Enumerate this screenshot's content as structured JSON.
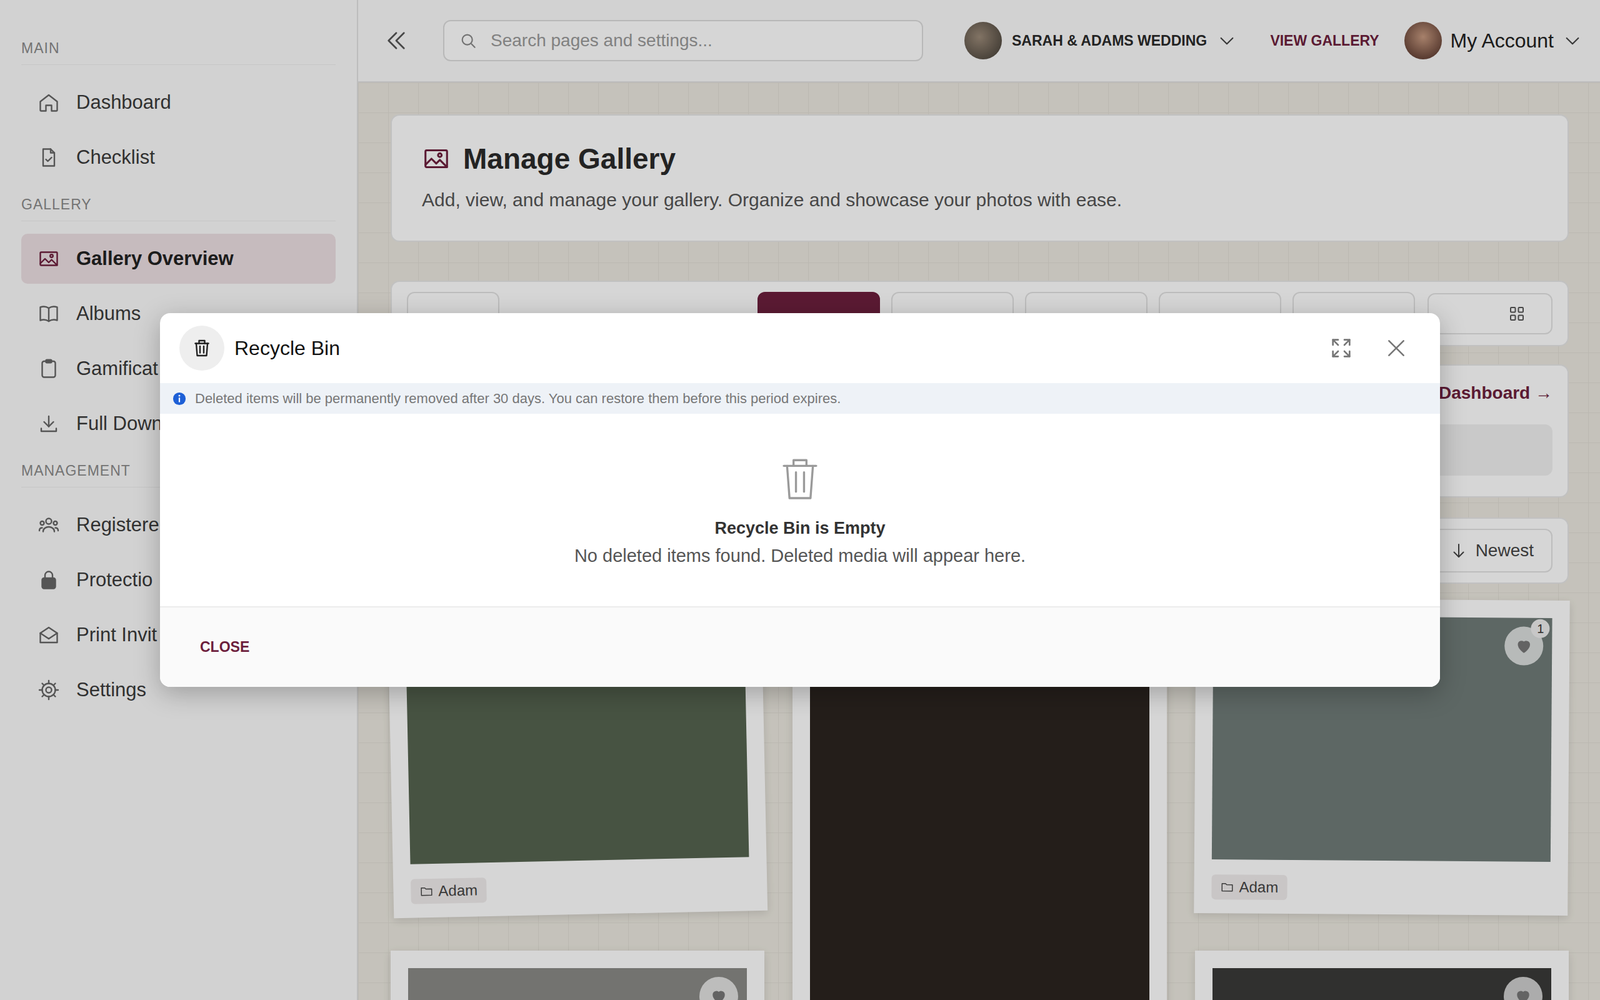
{
  "sidebar": {
    "sections": [
      {
        "title": "MAIN",
        "items": [
          {
            "label": "Dashboard",
            "selected": false
          },
          {
            "label": "Checklist",
            "selected": false
          }
        ]
      },
      {
        "title": "GALLERY",
        "items": [
          {
            "label": "Gallery Overview",
            "selected": true
          },
          {
            "label": "Albums",
            "selected": false
          },
          {
            "label": "Gamificat",
            "selected": false
          },
          {
            "label": "Full Down",
            "selected": false
          }
        ]
      },
      {
        "title": "MANAGEMENT",
        "items": [
          {
            "label": "Registere",
            "selected": false
          },
          {
            "label": "Protectio",
            "selected": false
          },
          {
            "label": "Print Invit",
            "selected": false
          },
          {
            "label": "Settings",
            "selected": false
          }
        ]
      }
    ]
  },
  "topbar": {
    "search_placeholder": "Search pages and settings...",
    "event": "SARAH & ADAMS WEDDING",
    "view_gallery": "VIEW GALLERY",
    "account": "My Account"
  },
  "header": {
    "title": "Manage Gallery",
    "description": "Add, view, and manage your gallery. Organize and showcase your photos with ease."
  },
  "toolbar": {
    "tabs": [
      {
        "selected": false
      },
      {
        "selected": true
      },
      {
        "selected": false
      },
      {
        "selected": false
      },
      {
        "selected": false
      },
      {
        "selected": false
      }
    ]
  },
  "dashboard_link": "l Dashboard →",
  "sort": {
    "label": "Newest"
  },
  "photos": [
    {
      "tag": "Adam",
      "likes": "",
      "heart": false,
      "color": "#55634f"
    },
    {
      "tag": "",
      "likes": "",
      "heart": false,
      "color": "#2b2420"
    },
    {
      "tag": "Adam",
      "likes": "1",
      "heart": true,
      "color": "#6f7b78"
    },
    {
      "tag": "",
      "likes": "",
      "heart": true,
      "color": "#8a8a86"
    },
    {
      "tag": "",
      "likes": "",
      "heart": true,
      "color": "#3a3a38"
    }
  ],
  "modal": {
    "title": "Recycle Bin",
    "info": "Deleted items will be permanently removed after 30 days. You can restore them before this period expires.",
    "empty_title": "Recycle Bin is Empty",
    "empty_text": "No deleted items found. Deleted media will appear here.",
    "close": "CLOSE"
  }
}
